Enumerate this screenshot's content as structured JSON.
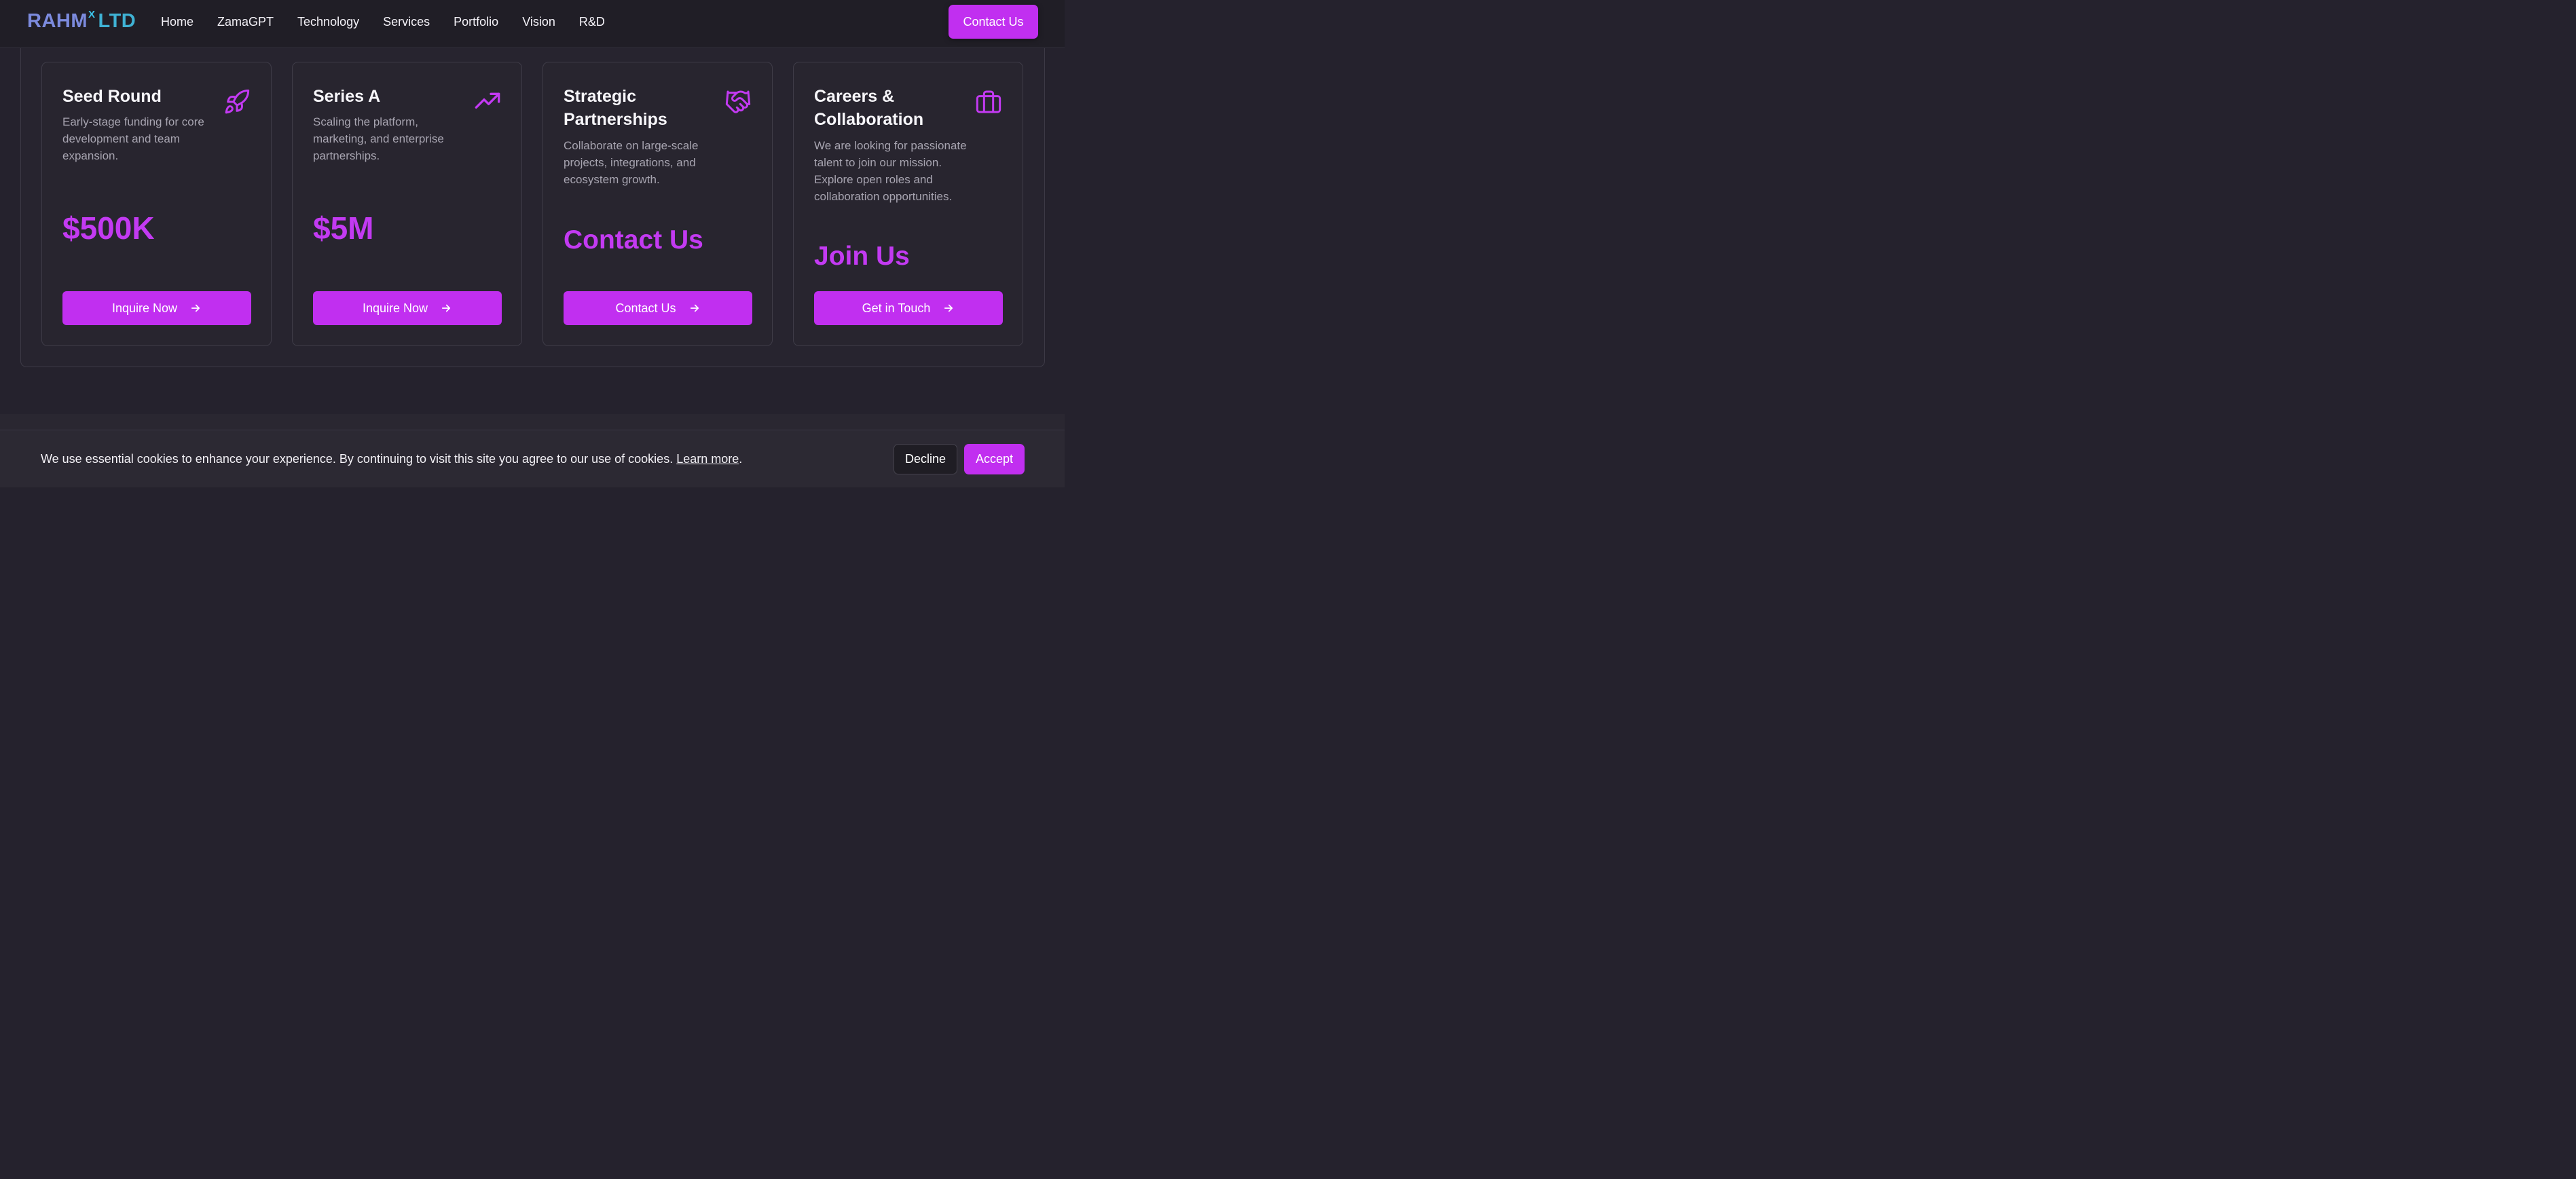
{
  "brand": {
    "part1": "RAHM",
    "sup": "X",
    "part2": "LTD"
  },
  "nav": [
    "Home",
    "ZamaGPT",
    "Technology",
    "Services",
    "Portfolio",
    "Vision",
    "R&D"
  ],
  "header_cta": "Contact Us",
  "cards": [
    {
      "title": "Seed Round",
      "description": "Early-stage funding for core development and team expansion.",
      "highlight": "$500K",
      "button": "Inquire Now",
      "icon": "rocket-icon"
    },
    {
      "title": "Series A",
      "description": "Scaling the platform, marketing, and enterprise partnerships.",
      "highlight": "$5M",
      "button": "Inquire Now",
      "icon": "trending-up-icon"
    },
    {
      "title": "Strategic Partnerships",
      "description": "Collaborate on large-scale projects, integrations, and ecosystem growth.",
      "highlight": "Contact Us",
      "button": "Contact Us",
      "icon": "handshake-icon"
    },
    {
      "title": "Careers & Collaboration",
      "description": "We are looking for passionate talent to join our mission. Explore open roles and collaboration opportunities.",
      "highlight": "Join Us",
      "button": "Get in Touch",
      "icon": "briefcase-icon"
    }
  ],
  "cookie": {
    "message": "We use essential cookies to enhance your experience. By continuing to visit this site you agree to our use of cookies.",
    "link": "Learn more",
    "decline": "Decline",
    "accept": "Accept"
  },
  "colors": {
    "accent": "#c12ff0",
    "background": "#25222d",
    "logo_blue": "#7c8bde",
    "logo_cyan": "#3fb2d4"
  }
}
